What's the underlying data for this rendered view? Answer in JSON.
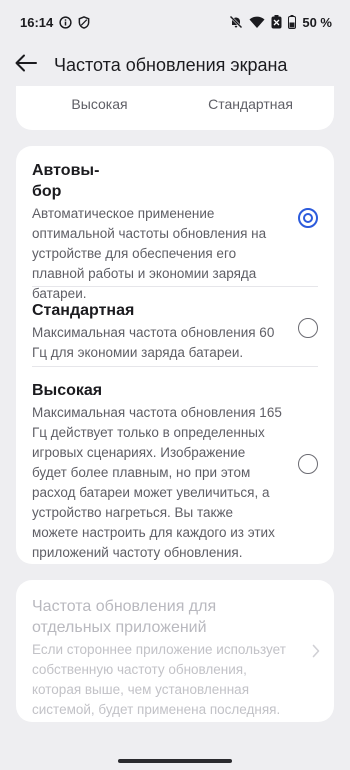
{
  "status_bar": {
    "time": "16:14",
    "battery_percent": "50 %",
    "left_icons": [
      "info-circle-icon",
      "shield-icon"
    ],
    "right_icons": [
      "bell-off-icon",
      "wifi-icon",
      "data-saver-icon",
      "battery-icon"
    ]
  },
  "header": {
    "title": "Частота обновления экрана",
    "back_icon": "arrow-left-icon"
  },
  "preview": {
    "labels": [
      "Высокая",
      "Стандартная"
    ]
  },
  "options": [
    {
      "title_line1": "Автовы-",
      "title_line2": "бор",
      "description": "Автоматическое применение оптимальной частоты обновления на устройстве для обеспечения его плавной работы и экономии заряда батареи.",
      "selected": true
    },
    {
      "title": "Стандартная",
      "description": "Максимальная частота обновления 60 Гц для экономии заряда батареи.",
      "selected": false
    },
    {
      "title": "Высокая",
      "description": "Максимальная частота обновления 165 Гц действует только в определенных игровых сценариях. Изображение будет более плавным, но при этом расход батареи может увеличиться, а устройство нагреться. Вы также можете настроить для каждого из этих приложений частоту обновления.",
      "selected": false
    }
  ],
  "app_refresh": {
    "title": "Частота обновления для отдельных приложений",
    "description": "Если стороннее приложение использует собственную частоту обновления, которая выше, чем установленная системой, будет применена последняя.",
    "enabled": false
  },
  "colors": {
    "accent": "#2c5bdc",
    "background": "#eeeef1",
    "card": "#ffffff"
  }
}
